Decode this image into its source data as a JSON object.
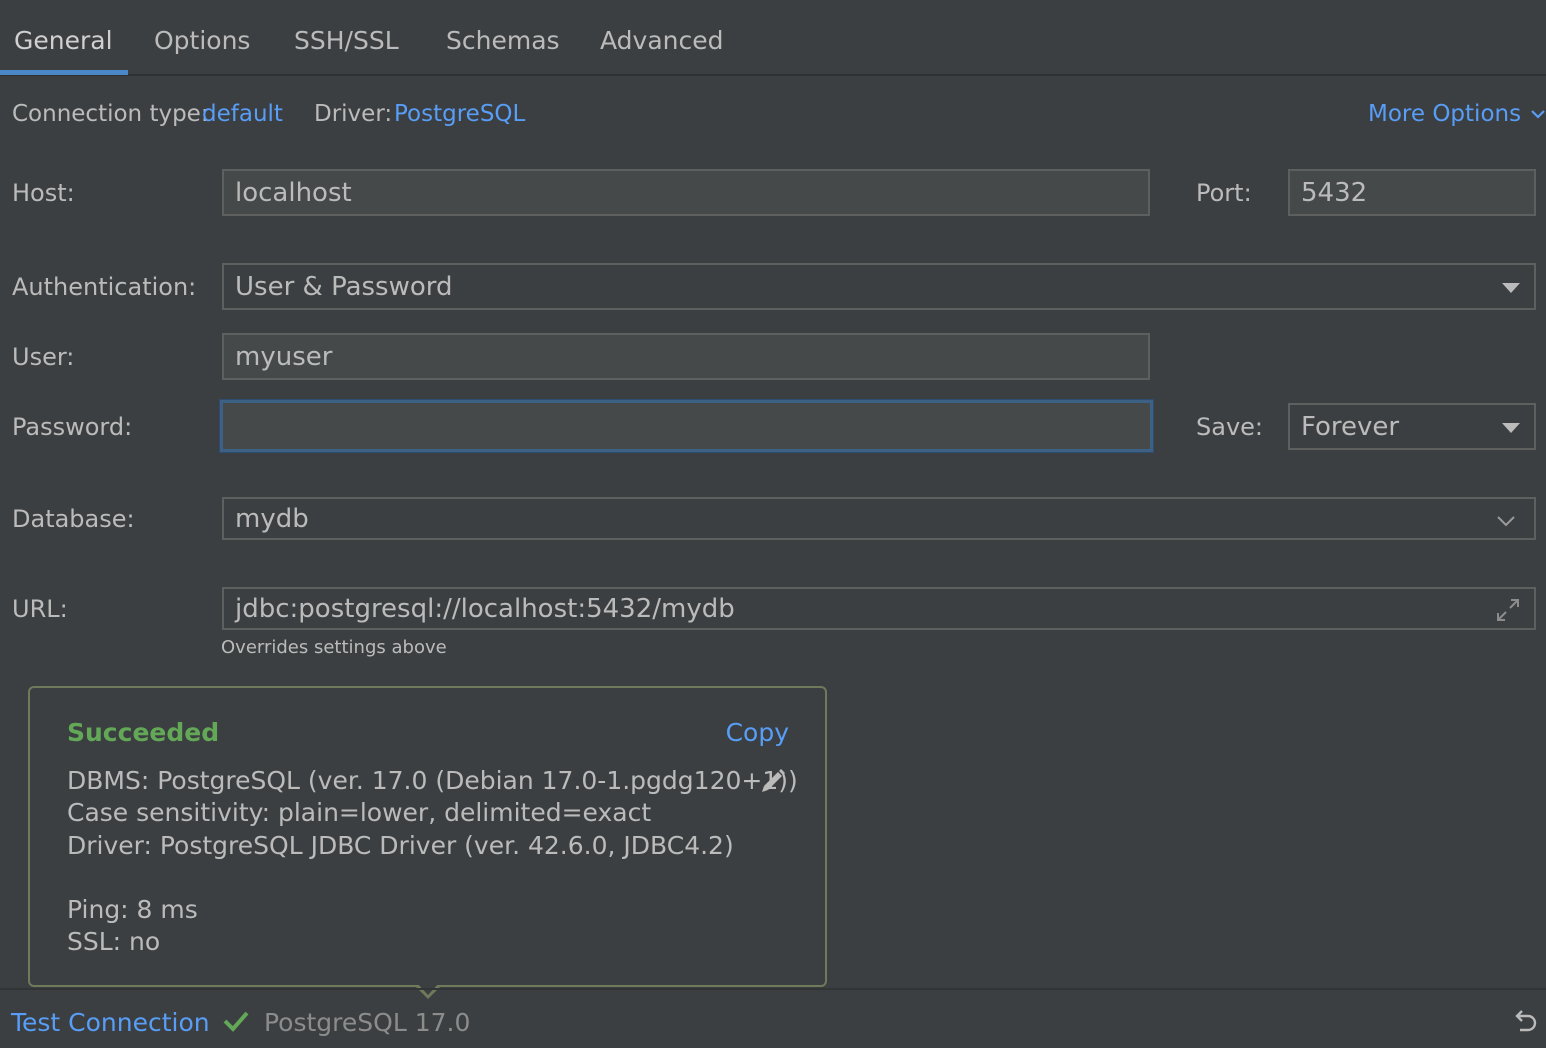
{
  "tabs": [
    {
      "label": "General",
      "active": true
    },
    {
      "label": "Options"
    },
    {
      "label": "SSH/SSL"
    },
    {
      "label": "Schemas"
    },
    {
      "label": "Advanced"
    }
  ],
  "connection": {
    "type_label": "Connection type:",
    "type_value": "default",
    "driver_label": "Driver:",
    "driver_value": "PostgreSQL",
    "more_options": "More Options"
  },
  "form": {
    "host_label": "Host:",
    "host_value": "localhost",
    "port_label": "Port:",
    "port_value": "5432",
    "auth_label": "Authentication:",
    "auth_value": "User & Password",
    "user_label": "User:",
    "user_value": "myuser",
    "password_label": "Password:",
    "password_value": "",
    "save_label": "Save:",
    "save_value": "Forever",
    "database_label": "Database:",
    "database_value": "mydb",
    "url_label": "URL:",
    "url_value": "jdbc:postgresql://localhost:5432/mydb",
    "url_hint": "Overrides settings above"
  },
  "popup": {
    "title": "Succeeded",
    "copy": "Copy",
    "dbms": "DBMS: PostgreSQL (ver. 17.0 (Debian 17.0-1.pgdg120+1))",
    "case": "Case sensitivity: plain=lower, delimited=exact",
    "driver": "Driver: PostgreSQL JDBC Driver (ver. 42.6.0, JDBC4.2)",
    "ping": "Ping: 8 ms",
    "ssl": "SSL: no"
  },
  "bottom": {
    "test_connection": "Test Connection",
    "status_text": "PostgreSQL 17.0"
  },
  "colors": {
    "background": "#3c3f41",
    "accent_link": "#589df6",
    "success": "#62a857",
    "focus_border": "#3d6185"
  }
}
